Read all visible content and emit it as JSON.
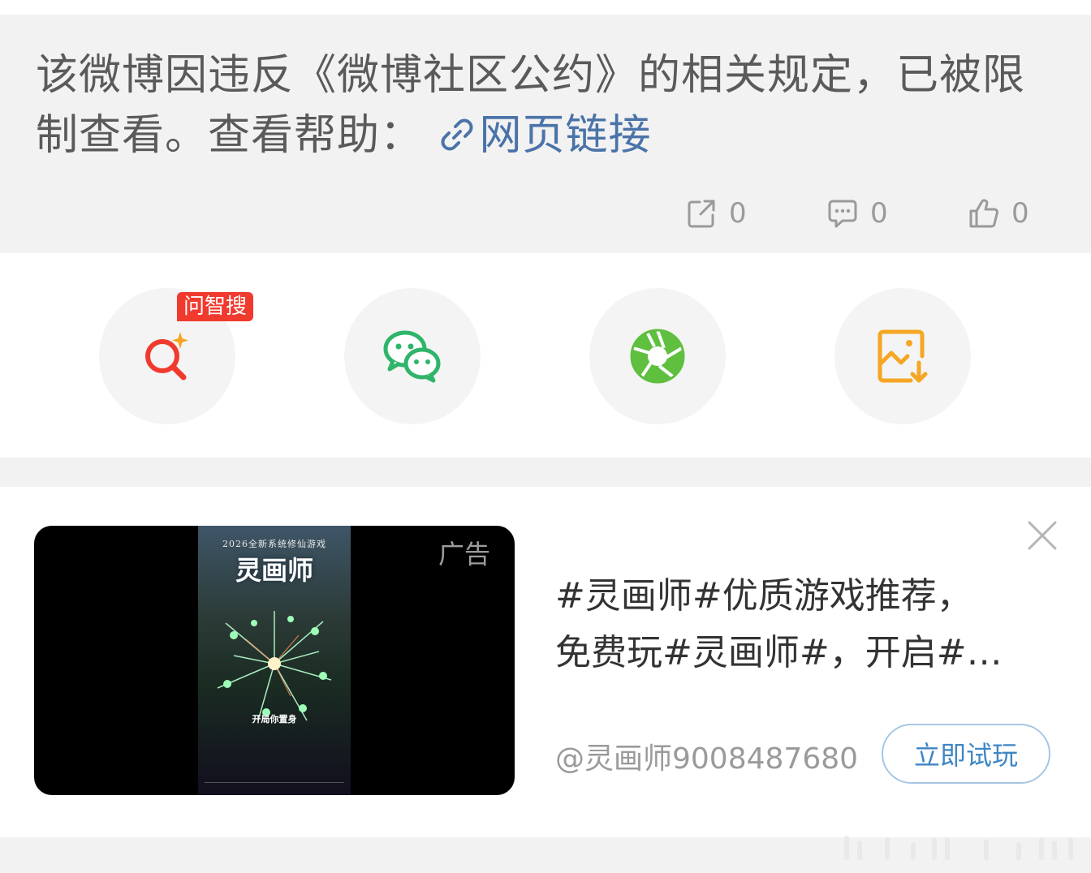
{
  "post": {
    "restricted_text": "该微博因违反《微博社区公约》的相关规定，已被限制查看。查看帮助：",
    "help_link_label": "网页链接",
    "link_icon": "link-icon",
    "repost": {
      "icon": "repost-icon",
      "count": "0"
    },
    "comment": {
      "icon": "comment-icon",
      "count": "0"
    },
    "like": {
      "icon": "thumbs-up-icon",
      "count": "0"
    }
  },
  "share": {
    "items": [
      {
        "icon": "ai-search-icon",
        "badge": "问智搜",
        "color": "#f03a2e"
      },
      {
        "icon": "wechat-icon",
        "color": "#2fb56a"
      },
      {
        "icon": "moments-icon",
        "color": "#5fbf3f"
      },
      {
        "icon": "save-image-icon",
        "color": "#f5a623"
      }
    ]
  },
  "ad": {
    "label": "广告",
    "poster_subtitle": "2026全新系统修仙游戏",
    "poster_title": "灵画师",
    "poster_caption": "开局你置身",
    "description_line1": "#灵画师#优质游戏推荐，",
    "description_line2": "免费玩#灵画师#，开启#…",
    "author": "@灵画师9008487680",
    "cta_label": "立即试玩",
    "close_icon": "close-icon"
  }
}
